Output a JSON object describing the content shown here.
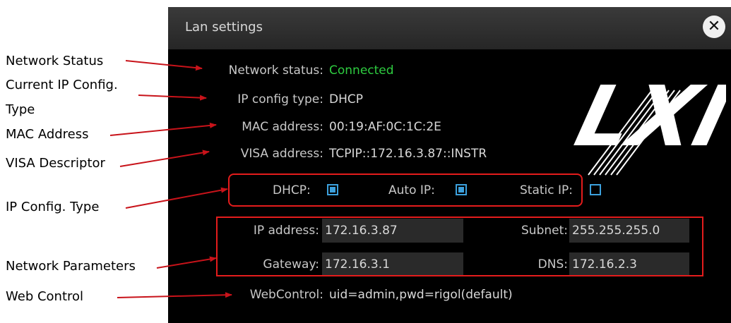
{
  "callouts": {
    "network_status": "Network Status",
    "current_ip_config_1": "Current IP Config.",
    "current_ip_config_2": "Type",
    "mac_address": "MAC Address",
    "visa_descriptor": "VISA Descriptor",
    "ip_config_type": "IP Config. Type",
    "network_parameters": "Network Parameters",
    "web_control": "Web Control"
  },
  "dialog": {
    "title": "Lan settings",
    "close_glyph": "✕",
    "logo_text": "LXI",
    "network_status_label": "Network status:",
    "network_status_value": "Connected",
    "ip_config_type_label": "IP config type:",
    "ip_config_type_value": "DHCP",
    "mac_label": "MAC address:",
    "mac_value": "00:19:AF:0C:1C:2E",
    "visa_label": "VISA address:",
    "visa_value": "TCPIP::172.16.3.87::INSTR",
    "config_options": {
      "dhcp_label": "DHCP:",
      "dhcp_checked": true,
      "autoip_label": "Auto IP:",
      "autoip_checked": true,
      "static_label": "Static IP:",
      "static_checked": false
    },
    "params": {
      "ip_label": "IP address:",
      "ip_value": "172.16.3.87",
      "subnet_label": "Subnet:",
      "subnet_value": "255.255.255.0",
      "gateway_label": "Gateway:",
      "gateway_value": "172.16.3.1",
      "dns_label": "DNS:",
      "dns_value": "172.16.2.3"
    },
    "webcontrol_label": "WebControl:",
    "webcontrol_value": "uid=admin,pwd=rigol(default)"
  },
  "colors": {
    "connected": "#2ecc40",
    "annotation": "#e41c1c",
    "checkbox": "#3ca0dc"
  }
}
